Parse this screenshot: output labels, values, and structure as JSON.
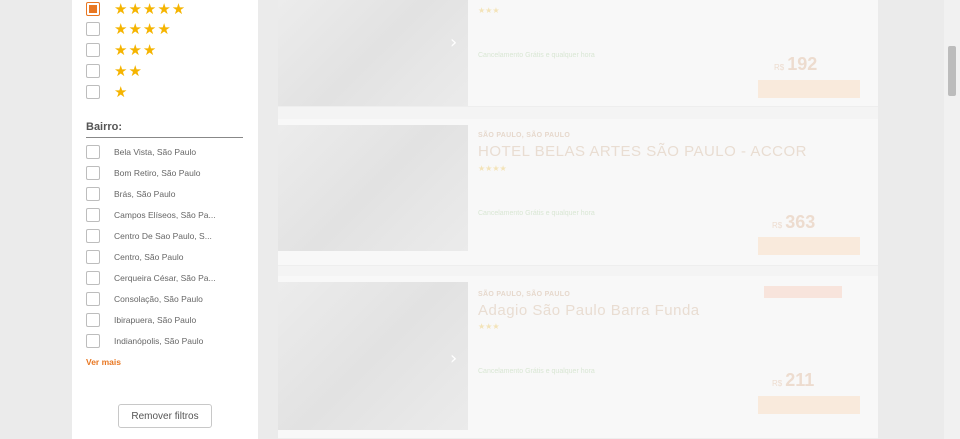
{
  "filters": {
    "stars": [
      {
        "stars": "★★★★★",
        "checked": true
      },
      {
        "stars": "★★★★",
        "checked": false
      },
      {
        "stars": "★★★",
        "checked": false
      },
      {
        "stars": "★★",
        "checked": false
      },
      {
        "stars": "★",
        "checked": false
      }
    ],
    "neighborhood_title": "Bairro:",
    "neighborhoods": [
      "Bela Vista, São Paulo",
      "Bom Retiro, São Paulo",
      "Brás, São Paulo",
      "Campos Elíseos, São Pa...",
      "Centro De Sao Paulo, S...",
      "Centro, São Paulo",
      "Cerqueira César, São Pa...",
      "Consolação, São Paulo",
      "Ibirapuera, São Paulo",
      "Indianópolis, São Paulo"
    ],
    "see_more": "Ver mais",
    "remove_filters": "Remover filtros"
  },
  "results": [
    {
      "location": "",
      "name": "",
      "stars": "★★★",
      "cancellation": "Cancelamento Grátis e qualquer hora",
      "currency": "R$",
      "price": "192"
    },
    {
      "location": "SÃO PAULO, SÃO PAULO",
      "name": "HOTEL BELAS ARTES SÃO PAULO - ACCOR",
      "stars": "★★★★",
      "cancellation": "Cancelamento Grátis e qualquer hora",
      "currency": "R$",
      "price": "363"
    },
    {
      "location": "SÃO PAULO, SÃO PAULO",
      "name": "Adagio São Paulo Barra Funda",
      "stars": "★★★",
      "cancellation": "Cancelamento Grátis e qualquer hora",
      "currency": "R$",
      "price": "211"
    }
  ],
  "colors": {
    "accent": "#e87722",
    "star": "#f5b400",
    "overlay": "#f4f4f4"
  }
}
